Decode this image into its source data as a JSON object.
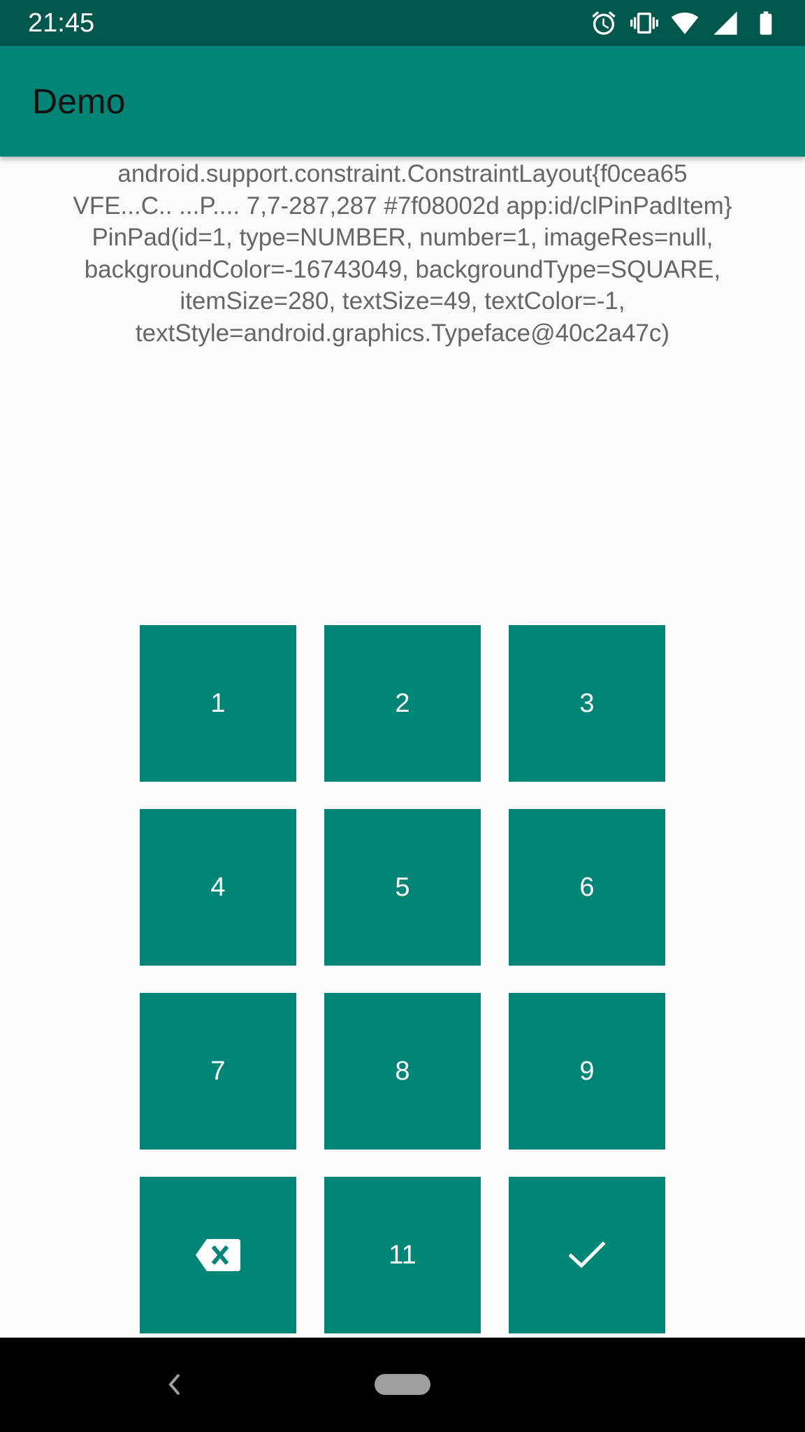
{
  "status_bar": {
    "time": "21:45",
    "icons": [
      "alarm-icon",
      "vibrate-icon",
      "wifi-icon",
      "signal-icon",
      "battery-icon"
    ]
  },
  "app_bar": {
    "title": "Demo"
  },
  "debug_text": {
    "lines": [
      "android.support.constraint.ConstraintLayout{f0cea65",
      "VFE...C.. ...P.... 7,7-287,287 #7f08002d app:id/clPinPadItem}",
      "PinPad(id=1, type=NUMBER, number=1, imageRes=null,",
      "backgroundColor=-16743049, backgroundType=SQUARE,",
      "itemSize=280, textSize=49, textColor=-1,",
      "textStyle=android.graphics.Typeface@40c2a47c)"
    ]
  },
  "pinpad": {
    "keys": [
      {
        "label": "1"
      },
      {
        "label": "2"
      },
      {
        "label": "3"
      },
      {
        "label": "4"
      },
      {
        "label": "5"
      },
      {
        "label": "6"
      },
      {
        "label": "7"
      },
      {
        "label": "8"
      },
      {
        "label": "9"
      },
      {
        "icon": "backspace-icon"
      },
      {
        "label": "11"
      },
      {
        "icon": "check-icon"
      }
    ]
  },
  "nav_bar": {
    "icons": [
      "back-icon",
      "home-pill-icon"
    ]
  },
  "colors": {
    "status_bar": "#00574b",
    "app_bar": "#008577",
    "key_background": "#008577",
    "key_text": "#ffffff",
    "debug_text": "#666666",
    "background": "#fafafa",
    "nav_bar": "#000000"
  }
}
